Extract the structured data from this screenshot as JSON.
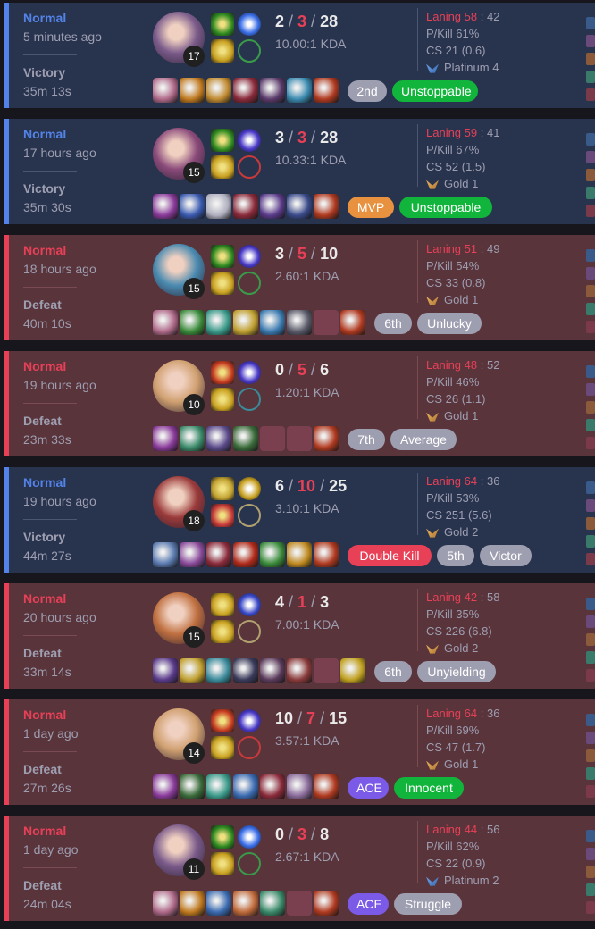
{
  "matches": [
    {
      "result_type": "win",
      "mode": "Normal",
      "ago": "5 minutes ago",
      "result": "Victory",
      "duration": "35m 13s",
      "level": "17",
      "kills": "2",
      "deaths": "3",
      "assists": "28",
      "ratio": "10.00:1 KDA",
      "laning_label": "Laning 58",
      "laning_opp": "42",
      "pkill": "P/Kill 61%",
      "cs": "CS 21 (0.6)",
      "tier": "Platinum 4",
      "tier_icon": "platinum",
      "champ_color": "#7a5a8a",
      "spells": [
        "#2d8a20",
        "#c8a020"
      ],
      "runes": [
        "#3a6ee8",
        "#3a9a4a"
      ],
      "items": [
        "#b06a8a",
        "#c07a20",
        "#c08a30",
        "#8a2a3a",
        "#5a3a6a",
        "#3a8ab0",
        "#b03a20"
      ],
      "badges": [
        {
          "text": "2nd",
          "style": "rank",
          "w": 44
        },
        {
          "text": "Unstoppable",
          "style": "green",
          "w": 96
        }
      ]
    },
    {
      "result_type": "win",
      "mode": "Normal",
      "ago": "17 hours ago",
      "result": "Victory",
      "duration": "35m 30s",
      "level": "15",
      "kills": "3",
      "deaths": "3",
      "assists": "28",
      "ratio": "10.33:1 KDA",
      "laning_label": "Laning 59",
      "laning_opp": "41",
      "pkill": "P/Kill 67%",
      "cs": "CS 52 (1.5)",
      "tier": "Gold 1",
      "tier_icon": "gold",
      "champ_color": "#8a4a7a",
      "spells": [
        "#2d8a20",
        "#c8a020"
      ],
      "runes": [
        "#4a3ac8",
        "#c83a3a"
      ],
      "items": [
        "#8a3a9a",
        "#3a5ab0",
        "#b0b0c0",
        "#8a2a3a",
        "#5a3a8a",
        "#3a4a8a",
        "#b03a20"
      ],
      "badges": [
        {
          "text": "MVP",
          "style": "gold",
          "w": 52
        },
        {
          "text": "Unstoppable",
          "style": "green",
          "w": 104
        }
      ]
    },
    {
      "result_type": "loss",
      "mode": "Normal",
      "ago": "18 hours ago",
      "result": "Defeat",
      "duration": "40m 10s",
      "level": "15",
      "kills": "3",
      "deaths": "5",
      "assists": "10",
      "ratio": "2.60:1 KDA",
      "laning_label": "Laning 51",
      "laning_opp": "49",
      "pkill": "P/Kill 54%",
      "cs": "CS 33 (0.8)",
      "tier": "Gold 1",
      "tier_icon": "gold",
      "champ_color": "#4a8ab0",
      "spells": [
        "#2d8a20",
        "#c8a020"
      ],
      "runes": [
        "#4a3ac8",
        "#3a9a4a"
      ],
      "items": [
        "#b06a8a",
        "#3a8a3a",
        "#3a9a8a",
        "#c0a030",
        "#3a7ab0",
        "#5a5a6a",
        "empty",
        "#b03a20"
      ],
      "badges": [
        {
          "text": "6th",
          "style": "rank",
          "w": 42
        },
        {
          "text": "Unlucky",
          "style": "gray",
          "w": 72
        }
      ]
    },
    {
      "result_type": "loss",
      "mode": "Normal",
      "ago": "19 hours ago",
      "result": "Defeat",
      "duration": "23m 33s",
      "level": "10",
      "kills": "0",
      "deaths": "5",
      "assists": "6",
      "ratio": "1.20:1 KDA",
      "laning_label": "Laning 48",
      "laning_opp": "52",
      "pkill": "P/Kill 46%",
      "cs": "CS 26 (1.1)",
      "tier": "Gold 1",
      "tier_icon": "gold",
      "champ_color": "#d0a070",
      "spells": [
        "#c83a20",
        "#c8a020"
      ],
      "runes": [
        "#4a3ac8",
        "#3a8a9a"
      ],
      "items": [
        "#8a3a9a",
        "#3a8a6a",
        "#5a4a8a",
        "#3a6a3a",
        "empty",
        "empty",
        "#b03a20"
      ],
      "badges": [
        {
          "text": "7th",
          "style": "rank",
          "w": 42
        },
        {
          "text": "Average",
          "style": "gray",
          "w": 74
        }
      ]
    },
    {
      "result_type": "win",
      "mode": "Normal",
      "ago": "19 hours ago",
      "result": "Victory",
      "duration": "44m 27s",
      "level": "18",
      "kills": "6",
      "deaths": "10",
      "assists": "25",
      "ratio": "3.10:1 KDA",
      "laning_label": "Laning 64",
      "laning_opp": "36",
      "pkill": "P/Kill 53%",
      "cs": "CS 251 (5.6)",
      "tier": "Gold 2",
      "tier_icon": "gold",
      "champ_color": "#9a3a3a",
      "spells": [
        "#c0a030",
        "#c83a3a"
      ],
      "runes": [
        "#c8a020",
        "#b0a070"
      ],
      "items": [
        "#5a7ab0",
        "#8a4a9a",
        "#8a2a3a",
        "#b02a1a",
        "#3a8a3a",
        "#c08a20",
        "#b03a20"
      ],
      "badges": [
        {
          "text": "Double Kill",
          "style": "red",
          "w": 94
        },
        {
          "text": "5th",
          "style": "rank",
          "w": 42
        },
        {
          "text": "Victor",
          "style": "gray",
          "w": 58
        }
      ]
    },
    {
      "result_type": "loss",
      "mode": "Normal",
      "ago": "20 hours ago",
      "result": "Defeat",
      "duration": "33m 14s",
      "level": "15",
      "kills": "4",
      "deaths": "1",
      "assists": "3",
      "ratio": "7.00:1 KDA",
      "laning_label": "Laning 42",
      "laning_opp": "58",
      "pkill": "P/Kill 35%",
      "cs": "CS 226 (6.8)",
      "tier": "Gold 2",
      "tier_icon": "gold",
      "champ_color": "#c07040",
      "spells": [
        "#c8a020",
        "#c8a020"
      ],
      "runes": [
        "#3a4ac8",
        "#b0a070"
      ],
      "items": [
        "#5a3a8a",
        "#c0a030",
        "#3a8a9a",
        "#3a3a5a",
        "#5a3a5a",
        "#8a3a3a",
        "empty",
        "#c0a020"
      ],
      "badges": [
        {
          "text": "6th",
          "style": "rank",
          "w": 42
        },
        {
          "text": "Unyielding",
          "style": "gray",
          "w": 88
        }
      ]
    },
    {
      "result_type": "loss",
      "mode": "Normal",
      "ago": "1 day ago",
      "result": "Defeat",
      "duration": "27m 26s",
      "level": "14",
      "kills": "10",
      "deaths": "7",
      "assists": "15",
      "ratio": "3.57:1 KDA",
      "laning_label": "Laning 64",
      "laning_opp": "36",
      "pkill": "P/Kill 69%",
      "cs": "CS 47 (1.7)",
      "tier": "Gold 1",
      "tier_icon": "gold",
      "champ_color": "#d0a070",
      "spells": [
        "#c83a20",
        "#c8a020"
      ],
      "runes": [
        "#4a3ac8",
        "#c83a3a"
      ],
      "items": [
        "#8a3a9a",
        "#3a6a3a",
        "#3a9a8a",
        "#3a6ab0",
        "#8a2a3a",
        "#8a6a9a",
        "#b03a20"
      ],
      "badges": [
        {
          "text": "ACE",
          "style": "purple",
          "w": 46
        },
        {
          "text": "Innocent",
          "style": "green",
          "w": 78
        }
      ]
    },
    {
      "result_type": "loss",
      "mode": "Normal",
      "ago": "1 day ago",
      "result": "Defeat",
      "duration": "24m 04s",
      "level": "11",
      "kills": "0",
      "deaths": "3",
      "assists": "8",
      "ratio": "2.67:1 KDA",
      "laning_label": "Laning 44",
      "laning_opp": "56",
      "pkill": "P/Kill 62%",
      "cs": "CS 22 (0.9)",
      "tier": "Platinum 2",
      "tier_icon": "platinum",
      "champ_color": "#7a5a8a",
      "spells": [
        "#2d8a20",
        "#c8a020"
      ],
      "runes": [
        "#3a6ee8",
        "#3a9a4a"
      ],
      "items": [
        "#b06a8a",
        "#c07a20",
        "#3a6ab0",
        "#c06a3a",
        "#3a8a6a",
        "empty",
        "#b03a20"
      ],
      "badges": [
        {
          "text": "ACE",
          "style": "purple",
          "w": 46
        },
        {
          "text": "Struggle",
          "style": "gray",
          "w": 76
        }
      ]
    }
  ]
}
